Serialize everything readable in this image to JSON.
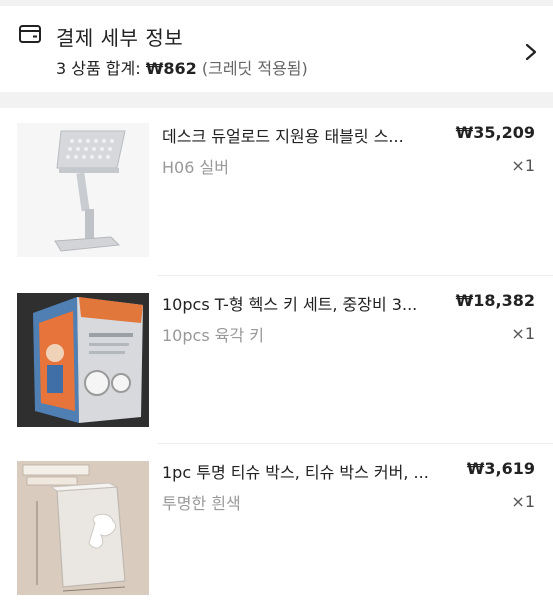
{
  "summary": {
    "title": "결제 세부 정보",
    "count_label": "3 상품 합계:",
    "total": "₩862",
    "credit_note": "(크레딧 적용됨)"
  },
  "items": [
    {
      "name": "데스크 듀얼로드 지원용 태블릿 스...",
      "price": "₩35,209",
      "variant": "H06 실버",
      "qty": "×1"
    },
    {
      "name": "10pcs T-형 헥스 키 세트, 중장비 3...",
      "price": "₩18,382",
      "variant": "10pcs 육각 키",
      "qty": "×1"
    },
    {
      "name": "1pc 투명 티슈 박스, 티슈 박스 커버, ...",
      "price": "₩3,619",
      "variant": "투명한 흰색",
      "qty": "×1"
    }
  ],
  "icons": {
    "summary_icon": "card-icon",
    "expand_icon": "chevron-right-icon"
  },
  "colors": {
    "text": "#222222",
    "muted": "#999999",
    "background_band": "#f2f2f2"
  }
}
